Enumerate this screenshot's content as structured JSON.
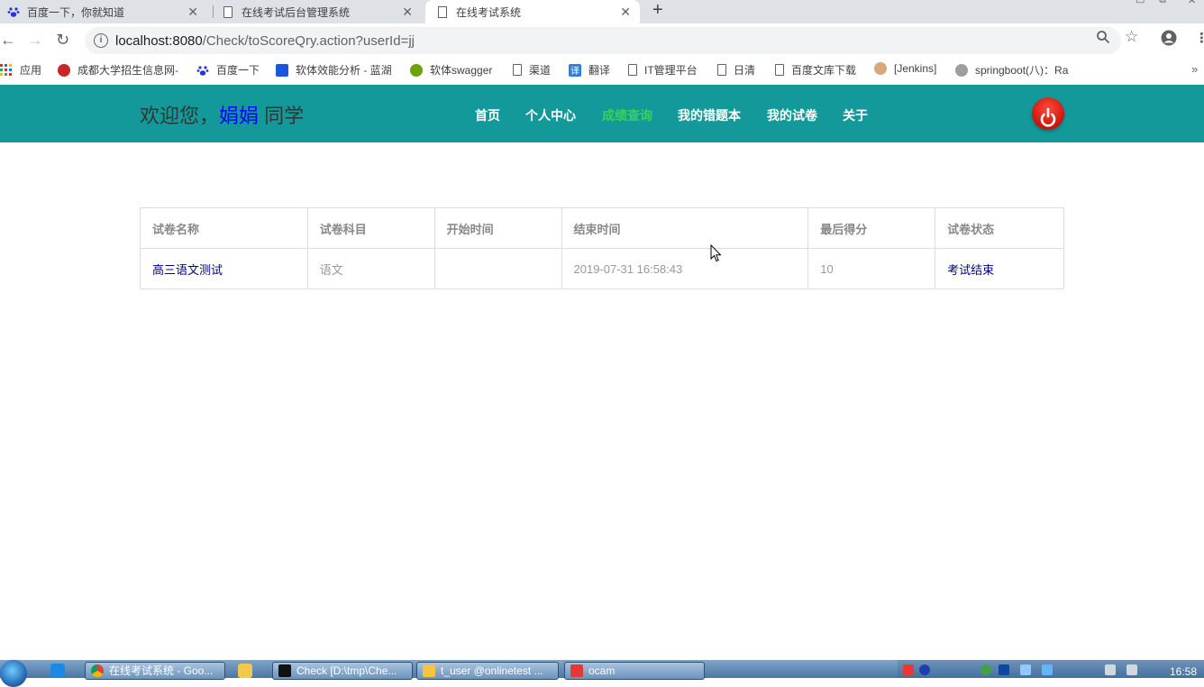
{
  "browser": {
    "tabs": [
      {
        "title": "百度一下，你就知道",
        "icon": "baidu-paw-icon"
      },
      {
        "title": "在线考试后台管理系统",
        "icon": "page-icon"
      },
      {
        "title": "在线考试系统",
        "icon": "page-icon",
        "active": true
      }
    ],
    "new_tab": "+",
    "close_glyph": "✕",
    "url_host": "localhost:8080",
    "url_path": "/Check/toScoreQry.action?userId=jj",
    "bookmarks": [
      {
        "label": "应用",
        "icon": "apps-grid-icon"
      },
      {
        "label": "成都大学招生信息网-",
        "icon": "cdu-icon"
      },
      {
        "label": "百度一下",
        "icon": "baidu-paw-icon"
      },
      {
        "label": "软体效能分析 - 蓝湖",
        "icon": "lanhu-icon"
      },
      {
        "label": "软体swagger",
        "icon": "swagger-icon"
      },
      {
        "label": "渠道",
        "icon": "page-icon"
      },
      {
        "label": "翻译",
        "icon": "translate-icon"
      },
      {
        "label": "IT管理平台",
        "icon": "page-icon"
      },
      {
        "label": "日清",
        "icon": "page-icon"
      },
      {
        "label": "百度文库下载",
        "icon": "page-icon"
      },
      {
        "label": "[Jenkins]",
        "icon": "jenkins-icon"
      },
      {
        "label": "springboot(八)：Ra",
        "icon": "springboot-icon"
      }
    ]
  },
  "header": {
    "welcome_prefix": "欢迎您，",
    "user_name": "娟娟",
    "welcome_suffix": " 同学",
    "nav": [
      {
        "label": "首页"
      },
      {
        "label": "个人中心"
      },
      {
        "label": "成绩查询",
        "active": true
      },
      {
        "label": "我的错题本"
      },
      {
        "label": "我的试卷"
      },
      {
        "label": "关于"
      }
    ],
    "colors": {
      "bar": "#13999a",
      "active_nav": "#35d35e",
      "user_name": "#0000ff"
    }
  },
  "table": {
    "columns": [
      "试卷名称",
      "试卷科目",
      "开始时间",
      "结束时间",
      "最后得分",
      "试卷状态"
    ],
    "rows": [
      {
        "name": "高三语文测试",
        "subject": "语文",
        "start": "",
        "end": "2019-07-31 16:58:43",
        "score": "10",
        "status": "考试结束"
      }
    ]
  },
  "taskbar": {
    "windows": [
      {
        "label": "在线考试系统 - Goo...",
        "icon": "chrome-icon"
      },
      {
        "label": "Check [D:\\tmp\\Che...",
        "icon": "intellij-icon"
      },
      {
        "label": "t_user @onlinetest ...",
        "icon": "navicat-icon"
      },
      {
        "label": "ocam",
        "icon": "ocam-icon"
      }
    ],
    "clock": "16:58"
  }
}
